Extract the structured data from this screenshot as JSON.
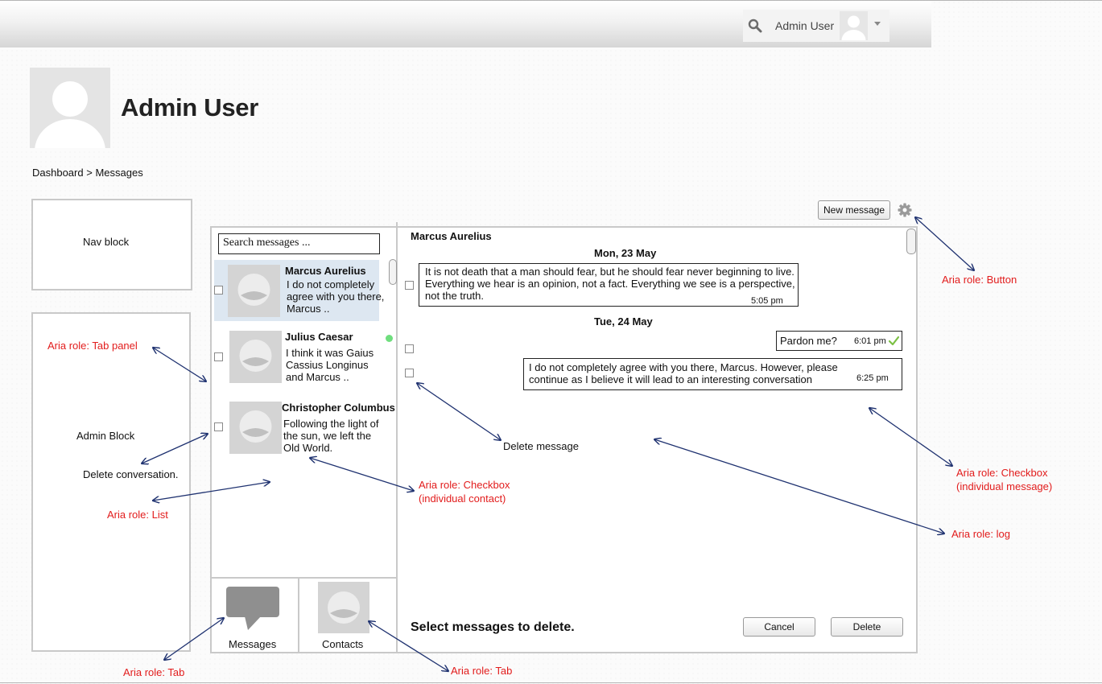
{
  "header": {
    "username": "Admin User"
  },
  "profile": {
    "name": "Admin User"
  },
  "breadcrumb": {
    "items": [
      "Dashboard",
      "Messages"
    ],
    "separator": ">"
  },
  "blocks": {
    "nav": "Nav block",
    "admin": "Admin Block",
    "delete_conversation": "Delete conversation."
  },
  "contacts": {
    "search_placeholder": "Search messages ...",
    "items": [
      {
        "name": "Marcus Aurelius",
        "preview": "I do not completely agree with you there, Marcus ..",
        "selected": true,
        "online": false
      },
      {
        "name": "Julius Caesar",
        "preview": "I think it was Gaius Cassius Longinus and Marcus ..",
        "selected": false,
        "online": true
      },
      {
        "name": "Christopher Columbus",
        "preview": "Following the light of the sun, we left the Old World.",
        "selected": false,
        "online": false
      }
    ]
  },
  "tabs": [
    {
      "label": "Messages",
      "icon": "speech-bubble-icon"
    },
    {
      "label": "Contacts",
      "icon": "avatar"
    }
  ],
  "conversation": {
    "title": "Marcus Aurelius",
    "days": [
      {
        "label": "Mon, 23 May",
        "messages": [
          {
            "text": "It is not death that a man should fear, but he should fear never beginning to live. Everything we hear is an opinion, not a fact. Everything we see is a perspective, not the truth.",
            "time": "5:05 pm",
            "side": "left"
          }
        ]
      },
      {
        "label": "Tue, 24 May",
        "messages": [
          {
            "text": "Pardon me?",
            "time": "6:01 pm",
            "side": "right",
            "read": true
          },
          {
            "text": "I do not completely agree with you there, Marcus. However, please continue as I believe it will lead to an interesting conversation",
            "time": "6:25 pm",
            "side": "right"
          }
        ]
      }
    ],
    "new_message_label": "New message",
    "select_prompt": "Select messages to delete.",
    "cancel_label": "Cancel",
    "delete_label": "Delete"
  },
  "annotations": {
    "button": "Aria role: Button",
    "tab_panel": "Aria role: Tab panel",
    "list": "Aria role: List",
    "checkbox_contact_1": "Aria role: Checkbox",
    "checkbox_contact_2": "(individual contact)",
    "delete_message": "Delete message",
    "checkbox_message_1": "Aria role: Checkbox",
    "checkbox_message_2": "(individual message)",
    "log": "Aria role: log",
    "tab_left": "Aria role: Tab",
    "tab_right": "Aria role: Tab"
  },
  "colors": {
    "annotation": "#e21c1c",
    "arrow": "#1f3270",
    "selected_contact": "#dde7f1",
    "online": "#6fde7e",
    "read_check": "#7bc043"
  }
}
